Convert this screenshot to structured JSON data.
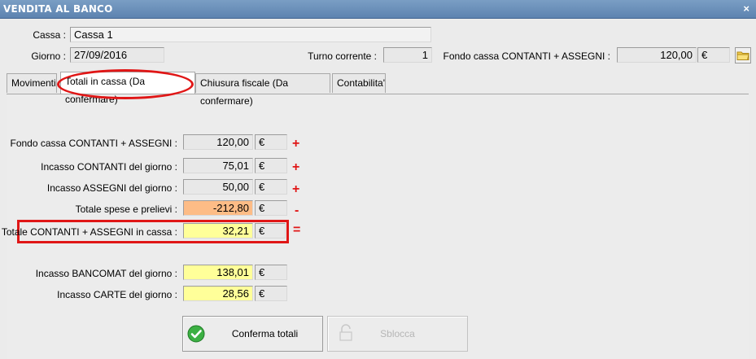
{
  "window": {
    "title": "VENDITA AL BANCO",
    "close_glyph": "×"
  },
  "header": {
    "cassa_label": "Cassa :",
    "cassa_value": "Cassa 1",
    "giorno_label": "Giorno :",
    "giorno_value": "27/09/2016",
    "turno_label": "Turno corrente :",
    "turno_value": "1",
    "fondo_label": "Fondo cassa CONTANTI + ASSEGNI :",
    "fondo_value": "120,00",
    "fondo_currency": "€"
  },
  "tabs": [
    {
      "label": "Movimenti"
    },
    {
      "label": "Totali in cassa (Da confermare)",
      "active": true
    },
    {
      "label": "Chiusura fiscale (Da confermare)"
    },
    {
      "label": "Contabilita'"
    }
  ],
  "totals": [
    {
      "label": "Fondo cassa CONTANTI + ASSEGNI :",
      "value": "120,00",
      "currency": "€",
      "sign": "+"
    },
    {
      "label": "Incasso CONTANTI del giorno :",
      "value": "75,01",
      "currency": "€",
      "sign": "+"
    },
    {
      "label": "Incasso ASSEGNI del giorno :",
      "value": "50,00",
      "currency": "€",
      "sign": "+"
    },
    {
      "label": "Totale spese e prelievi :",
      "value": "-212,80",
      "currency": "€",
      "sign": "-"
    },
    {
      "label": "Totale CONTANTI + ASSEGNI in cassa :",
      "value": "32,21",
      "currency": "€",
      "sign": "="
    }
  ],
  "cards": [
    {
      "label": "Incasso BANCOMAT del giorno :",
      "value": "138,01",
      "currency": "€"
    },
    {
      "label": "Incasso CARTE del giorno :",
      "value": "28,56",
      "currency": "€"
    }
  ],
  "buttons": {
    "confirm": "Conferma totali",
    "unlock": "Sblocca"
  },
  "colors": {
    "highlight": "#e01616",
    "yellow": "#ffff99",
    "orange": "#fdbc86",
    "titlebar": "#6b8fb9"
  }
}
